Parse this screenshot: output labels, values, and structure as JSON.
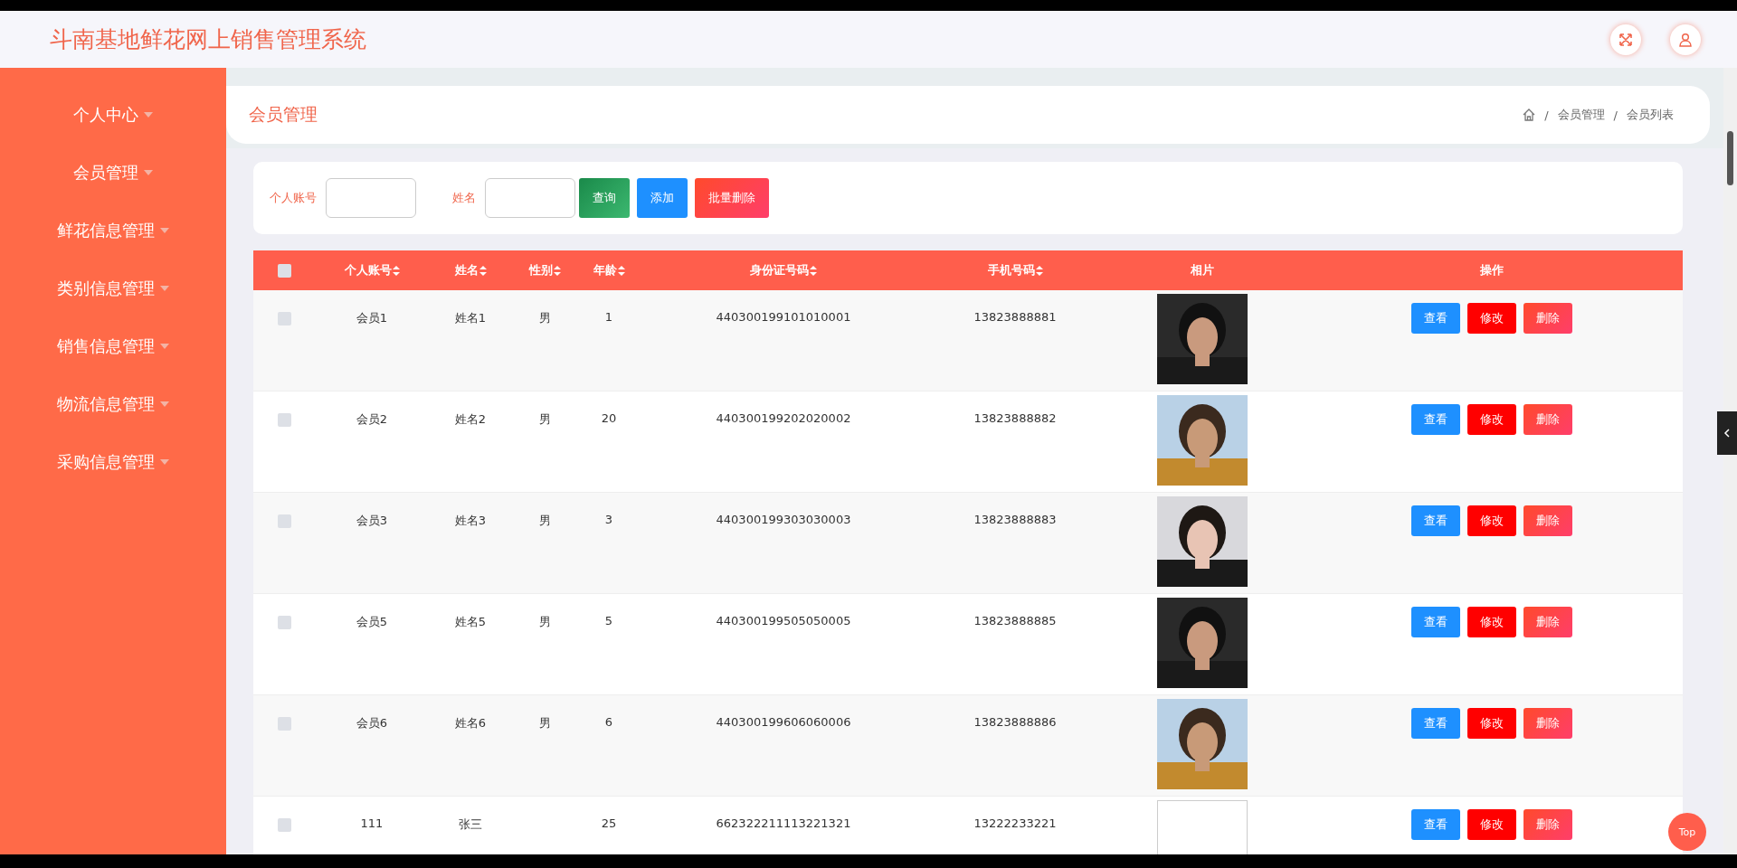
{
  "header": {
    "title": "斗南基地鲜花网上销售管理系统"
  },
  "sidebar": {
    "items": [
      {
        "label": "个人中心"
      },
      {
        "label": "会员管理"
      },
      {
        "label": "鲜花信息管理"
      },
      {
        "label": "类别信息管理"
      },
      {
        "label": "销售信息管理"
      },
      {
        "label": "物流信息管理"
      },
      {
        "label": "采购信息管理"
      }
    ]
  },
  "page_title": "会员管理",
  "breadcrumb": [
    {
      "separator": "/",
      "label": "会员管理"
    },
    {
      "separator": "/",
      "label": "会员列表"
    }
  ],
  "search": {
    "fields": [
      {
        "label": "个人账号"
      },
      {
        "label": "姓名"
      }
    ],
    "buttons": [
      {
        "label": "查询",
        "kind": "search"
      },
      {
        "label": "添加",
        "kind": "add"
      },
      {
        "label": "批量删除",
        "kind": "delete"
      }
    ]
  },
  "table": {
    "select_all_checked": false,
    "columns": [
      {
        "label": "个人账号",
        "sortable": true
      },
      {
        "label": "姓名",
        "sortable": true
      },
      {
        "label": "性别",
        "sortable": true
      },
      {
        "label": "年龄",
        "sortable": true
      },
      {
        "label": "身份证号码",
        "sortable": true
      },
      {
        "label": "手机号码",
        "sortable": true
      },
      {
        "label": "相片",
        "sortable": false
      },
      {
        "label": "操作",
        "sortable": false
      }
    ],
    "rows": [
      {
        "checked": false,
        "account": "会员1",
        "name": "姓名1",
        "sex": "男",
        "age": "1",
        "id_number": "440300199101010001",
        "phone": "13823888881",
        "actions": [
          {
            "label": "查看",
            "kind": "view"
          },
          {
            "label": "修改",
            "kind": "edit"
          },
          {
            "label": "删除",
            "kind": "delete"
          }
        ]
      },
      {
        "checked": false,
        "account": "会员2",
        "name": "姓名2",
        "sex": "男",
        "age": "20",
        "id_number": "440300199202020002",
        "phone": "13823888882",
        "actions": [
          {
            "label": "查看",
            "kind": "view"
          },
          {
            "label": "修改",
            "kind": "edit"
          },
          {
            "label": "删除",
            "kind": "delete"
          }
        ]
      },
      {
        "checked": false,
        "account": "会员3",
        "name": "姓名3",
        "sex": "男",
        "age": "3",
        "id_number": "440300199303030003",
        "phone": "13823888883",
        "actions": [
          {
            "label": "查看",
            "kind": "view"
          },
          {
            "label": "修改",
            "kind": "edit"
          },
          {
            "label": "删除",
            "kind": "delete"
          }
        ]
      },
      {
        "checked": false,
        "account": "会员5",
        "name": "姓名5",
        "sex": "男",
        "age": "5",
        "id_number": "440300199505050005",
        "phone": "13823888885",
        "actions": [
          {
            "label": "查看",
            "kind": "view"
          },
          {
            "label": "修改",
            "kind": "edit"
          },
          {
            "label": "删除",
            "kind": "delete"
          }
        ]
      },
      {
        "checked": false,
        "account": "会员6",
        "name": "姓名6",
        "sex": "男",
        "age": "6",
        "id_number": "440300199606060006",
        "phone": "13823888886",
        "actions": [
          {
            "label": "查看",
            "kind": "view"
          },
          {
            "label": "修改",
            "kind": "edit"
          },
          {
            "label": "删除",
            "kind": "delete"
          }
        ]
      },
      {
        "checked": false,
        "account": "111",
        "name": "张三",
        "age": "25",
        "id_number": "662322211113221321",
        "phone": "13222233221",
        "photo": {
          "kind": "broken"
        },
        "actions": [
          {
            "label": "查看",
            "kind": "view"
          },
          {
            "label": "修改",
            "kind": "edit"
          },
          {
            "label": "删除",
            "kind": "delete"
          }
        ]
      }
    ]
  },
  "top_button": "Top"
}
